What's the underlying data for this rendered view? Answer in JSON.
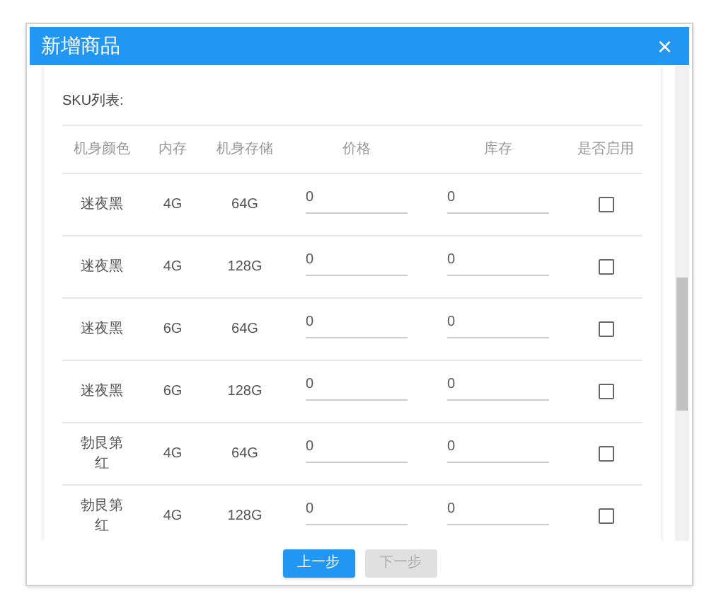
{
  "dialog": {
    "title": "新增商品",
    "close": "×"
  },
  "section_label": "SKU列表:",
  "table": {
    "columns": [
      "机身颜色",
      "内存",
      "机身存储",
      "价格",
      "库存",
      "是否启用"
    ],
    "rows": [
      {
        "body_finish": "迷夜黑",
        "memory": "4G",
        "storage": "64G",
        "price": "0",
        "stock": "0",
        "enabled": false
      },
      {
        "body_finish": "迷夜黑",
        "memory": "4G",
        "storage": "128G",
        "price": "0",
        "stock": "0",
        "enabled": false
      },
      {
        "body_finish": "迷夜黑",
        "memory": "6G",
        "storage": "64G",
        "price": "0",
        "stock": "0",
        "enabled": false
      },
      {
        "body_finish": "迷夜黑",
        "memory": "6G",
        "storage": "128G",
        "price": "0",
        "stock": "0",
        "enabled": false
      },
      {
        "body_finish": "勃艮第红",
        "memory": "4G",
        "storage": "64G",
        "price": "0",
        "stock": "0",
        "enabled": false
      },
      {
        "body_finish": "勃艮第红",
        "memory": "4G",
        "storage": "128G",
        "price": "0",
        "stock": "0",
        "enabled": false
      }
    ]
  },
  "buttons": [
    {
      "label": "上一步",
      "disabled": false
    },
    {
      "label": "下一步",
      "disabled": true
    }
  ]
}
